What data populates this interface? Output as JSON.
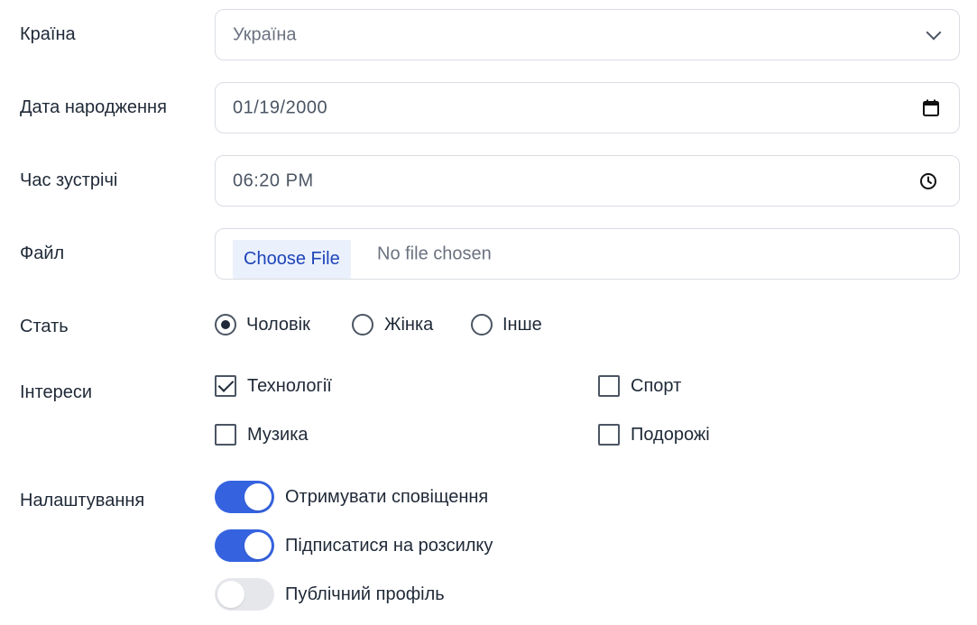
{
  "country": {
    "label": "Країна",
    "value": "Україна",
    "icon": "chevron-down-icon"
  },
  "birth_date": {
    "label": "Дата народження",
    "value": "01/19/2000",
    "icon": "calendar-icon"
  },
  "meeting_time": {
    "label": "Час зустрічі",
    "value": "06:20 PM",
    "icon": "clock-icon"
  },
  "file": {
    "label": "Файл",
    "button": "Choose File",
    "status": "No file chosen"
  },
  "gender": {
    "label": "Стать",
    "options": [
      {
        "label": "Чоловік",
        "checked": true
      },
      {
        "label": "Жінка",
        "checked": false
      },
      {
        "label": "Інше",
        "checked": false
      }
    ]
  },
  "interests": {
    "label": "Інтереси",
    "options": [
      {
        "label": "Технології",
        "checked": true
      },
      {
        "label": "Спорт",
        "checked": false
      },
      {
        "label": "Музика",
        "checked": false
      },
      {
        "label": "Подорожі",
        "checked": false
      }
    ]
  },
  "settings": {
    "label": "Налаштування",
    "toggles": [
      {
        "label": "Отримувати сповіщення",
        "on": true
      },
      {
        "label": "Підписатися на розсилку",
        "on": true
      },
      {
        "label": "Публічний профіль",
        "on": false
      }
    ]
  },
  "colors": {
    "accent": "#3563e0",
    "border": "#d9dde3",
    "text": "#1f2937",
    "muted": "#6b7280",
    "file_button_bg": "#eaf1fc",
    "file_button_text": "#1e44b8"
  }
}
